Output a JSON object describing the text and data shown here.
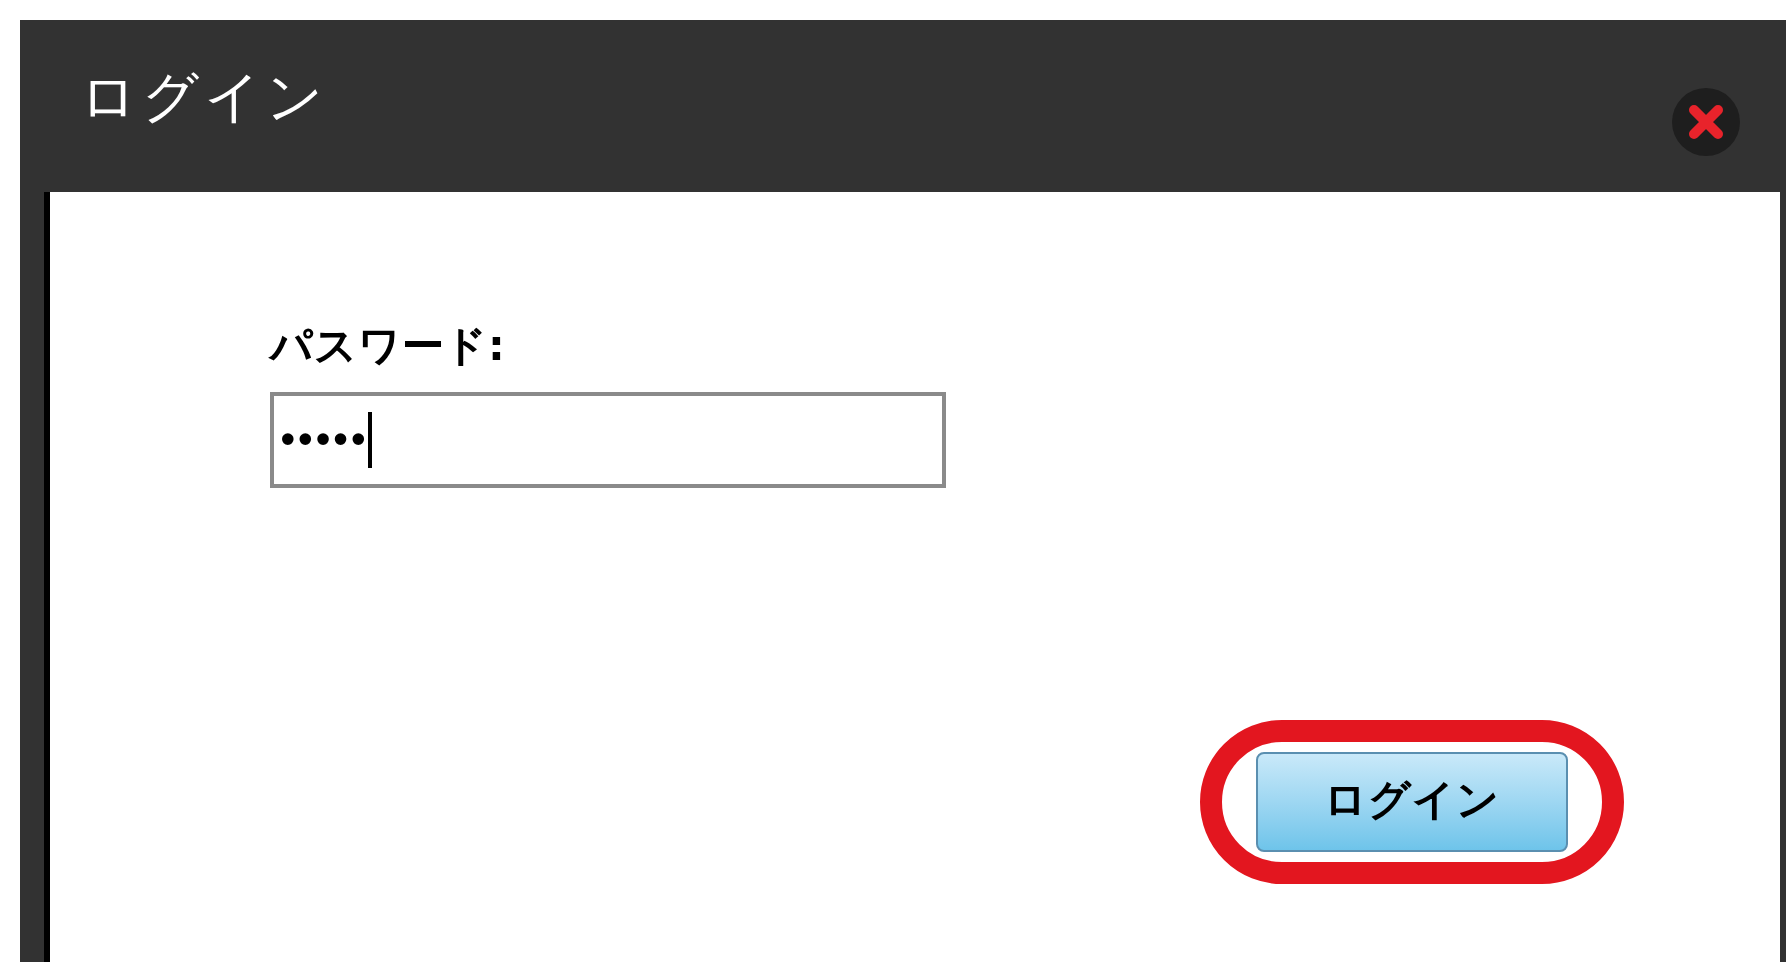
{
  "dialog": {
    "title": "ログイン",
    "password_label": "パスワード:",
    "password_field": {
      "value": "•••••",
      "focused": true
    },
    "login_button": {
      "label": "ログイン",
      "highlighted": true
    }
  }
}
